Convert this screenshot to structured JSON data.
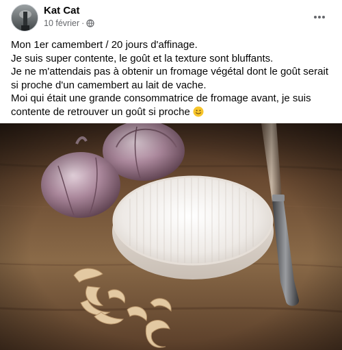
{
  "post": {
    "author": "Kat Cat",
    "date": "10 février",
    "separator": "·",
    "lines": [
      "Mon 1er camembert / 20 jours d'affinage.",
      "Je suis super contente, le goût et la texture sont bluffants.",
      "Je ne m'attendais pas à obtenir un fromage végétal dont le goût serait si proche d'un camembert au lait de vache.",
      "Moi qui était une grande consommatrice de fromage avant, je  suis contente de retrouver un goût si proche"
    ],
    "emoji": "slightly-smiling-face",
    "privacy_icon": "globe-icon",
    "menu_icon": "more-horizontal-icon"
  },
  "photo": {
    "subject": "camembert with garlic bulbs, cashews and a knife on a wooden board"
  },
  "colors": {
    "text": "#050505",
    "meta": "#65676b",
    "emoji": "#f7c52b"
  }
}
